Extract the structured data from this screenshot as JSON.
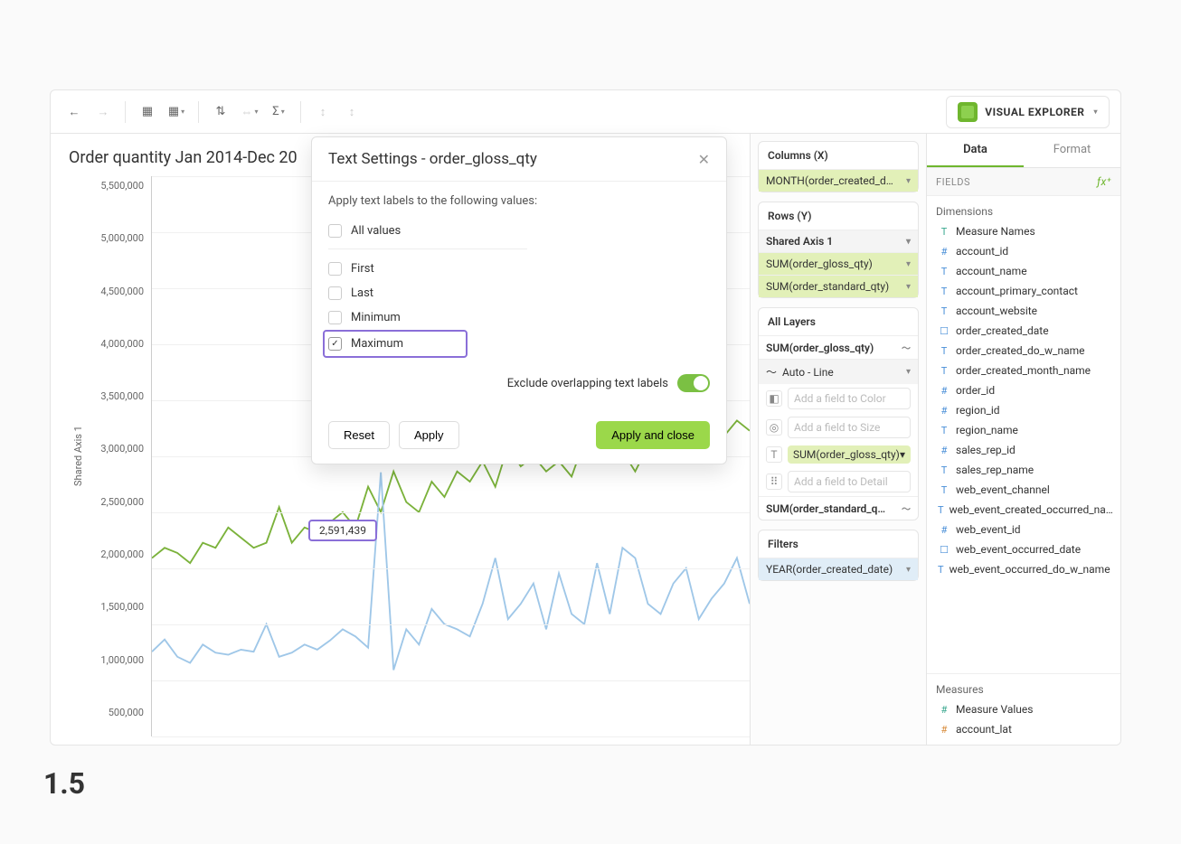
{
  "step_number": "1.5",
  "toolbar": {
    "app_name": "VISUAL EXPLORER"
  },
  "chart": {
    "title": "Order quantity Jan 2014-Dec 20",
    "yaxis_label": "Shared Axis 1",
    "ticks": [
      "5,500,000",
      "5,000,000",
      "4,500,000",
      "4,000,000",
      "3,500,000",
      "3,000,000",
      "2,500,000",
      "2,000,000",
      "1,500,000",
      "1,000,000",
      "500,000"
    ],
    "datalabel_max": "2,591,439"
  },
  "modal": {
    "title": "Text Settings - order_gloss_qty",
    "desc": "Apply text labels to the following values:",
    "opts": {
      "all": "All values",
      "first": "First",
      "last": "Last",
      "min": "Minimum",
      "max": "Maximum"
    },
    "exclude": "Exclude overlapping text labels",
    "reset": "Reset",
    "apply": "Apply",
    "apply_close": "Apply and close"
  },
  "shelves": {
    "columns_hdr": "Columns (X)",
    "col_pill": "MONTH(order_created_d…",
    "rows_hdr": "Rows (Y)",
    "shared_axis": "Shared Axis 1",
    "sum_gloss": "SUM(order_gloss_qty)",
    "sum_std": "SUM(order_standard_qty)",
    "all_layers": "All Layers",
    "auto_line": "Auto - Line",
    "color_ph": "Add a field to Color",
    "size_ph": "Add a field to Size",
    "text_pill": "SUM(order_gloss_qty)",
    "detail_ph": "Add a field to Detail",
    "sum_std_q": "SUM(order_standard_q…",
    "filters_hdr": "Filters",
    "filter_pill": "YEAR(order_created_date)"
  },
  "panel": {
    "tab_data": "Data",
    "tab_format": "Format",
    "fields_hdr": "FIELDS",
    "dimensions_hdr": "Dimensions",
    "measures_hdr": "Measures",
    "dims": [
      {
        "icon": "T",
        "cls": "t-teal",
        "label": "Measure Names"
      },
      {
        "icon": "#",
        "cls": "t-blue",
        "label": "account_id"
      },
      {
        "icon": "T",
        "cls": "t-blue",
        "label": "account_name"
      },
      {
        "icon": "T",
        "cls": "t-blue",
        "label": "account_primary_contact"
      },
      {
        "icon": "T",
        "cls": "t-blue",
        "label": "account_website"
      },
      {
        "icon": "☐",
        "cls": "t-blue",
        "label": "order_created_date"
      },
      {
        "icon": "T",
        "cls": "t-blue",
        "label": "order_created_do_w_name"
      },
      {
        "icon": "T",
        "cls": "t-blue",
        "label": "order_created_month_name"
      },
      {
        "icon": "#",
        "cls": "t-blue",
        "label": "order_id"
      },
      {
        "icon": "#",
        "cls": "t-blue",
        "label": "region_id"
      },
      {
        "icon": "T",
        "cls": "t-blue",
        "label": "region_name"
      },
      {
        "icon": "#",
        "cls": "t-blue",
        "label": "sales_rep_id"
      },
      {
        "icon": "T",
        "cls": "t-blue",
        "label": "sales_rep_name"
      },
      {
        "icon": "T",
        "cls": "t-blue",
        "label": "web_event_channel"
      },
      {
        "icon": "T",
        "cls": "t-blue",
        "label": "web_event_created_occurred_na…"
      },
      {
        "icon": "#",
        "cls": "t-blue",
        "label": "web_event_id"
      },
      {
        "icon": "☐",
        "cls": "t-blue",
        "label": "web_event_occurred_date"
      },
      {
        "icon": "T",
        "cls": "t-blue",
        "label": "web_event_occurred_do_w_name"
      }
    ],
    "meas": [
      {
        "icon": "#",
        "cls": "t-teal",
        "label": "Measure Values"
      },
      {
        "icon": "#",
        "cls": "t-orange",
        "label": "account_lat"
      }
    ]
  },
  "chart_data": {
    "type": "line",
    "ylabel": "Shared Axis 1",
    "ylim": [
      0,
      5500000
    ],
    "x_count": 48,
    "series": [
      {
        "name": "SUM(order_gloss_qty)",
        "color": "#7bb23b",
        "values": [
          1750000,
          1850000,
          1800000,
          1700000,
          1900000,
          1850000,
          2050000,
          1950000,
          1850000,
          1900000,
          2250000,
          1900000,
          2050000,
          2000000,
          2100000,
          2200000,
          2050000,
          2450000,
          2200000,
          2600000,
          2300000,
          2200000,
          2500000,
          2350000,
          2600000,
          2500000,
          2700000,
          2450000,
          2850000,
          2650000,
          2750000,
          2600000,
          2700000,
          2550000,
          2900000,
          2750000,
          2950000,
          2800000,
          2600000,
          2850000,
          2700000,
          3000000,
          2800000,
          3050000,
          2850000,
          2950000,
          3100000,
          3000000
        ]
      },
      {
        "name": "SUM(order_standard_qty)",
        "color": "#9fc7e8",
        "values": [
          830000,
          950000,
          780000,
          720000,
          900000,
          820000,
          800000,
          850000,
          830000,
          1100000,
          780000,
          820000,
          900000,
          850000,
          940000,
          1050000,
          980000,
          870000,
          2591439,
          650000,
          1050000,
          900000,
          1250000,
          1100000,
          1050000,
          980000,
          1300000,
          1750000,
          1150000,
          1300000,
          1500000,
          1050000,
          1600000,
          1200000,
          1100000,
          1700000,
          1200000,
          1850000,
          1750000,
          1300000,
          1200000,
          1500000,
          1650000,
          1150000,
          1350000,
          1500000,
          1750000,
          1300000
        ]
      }
    ]
  }
}
